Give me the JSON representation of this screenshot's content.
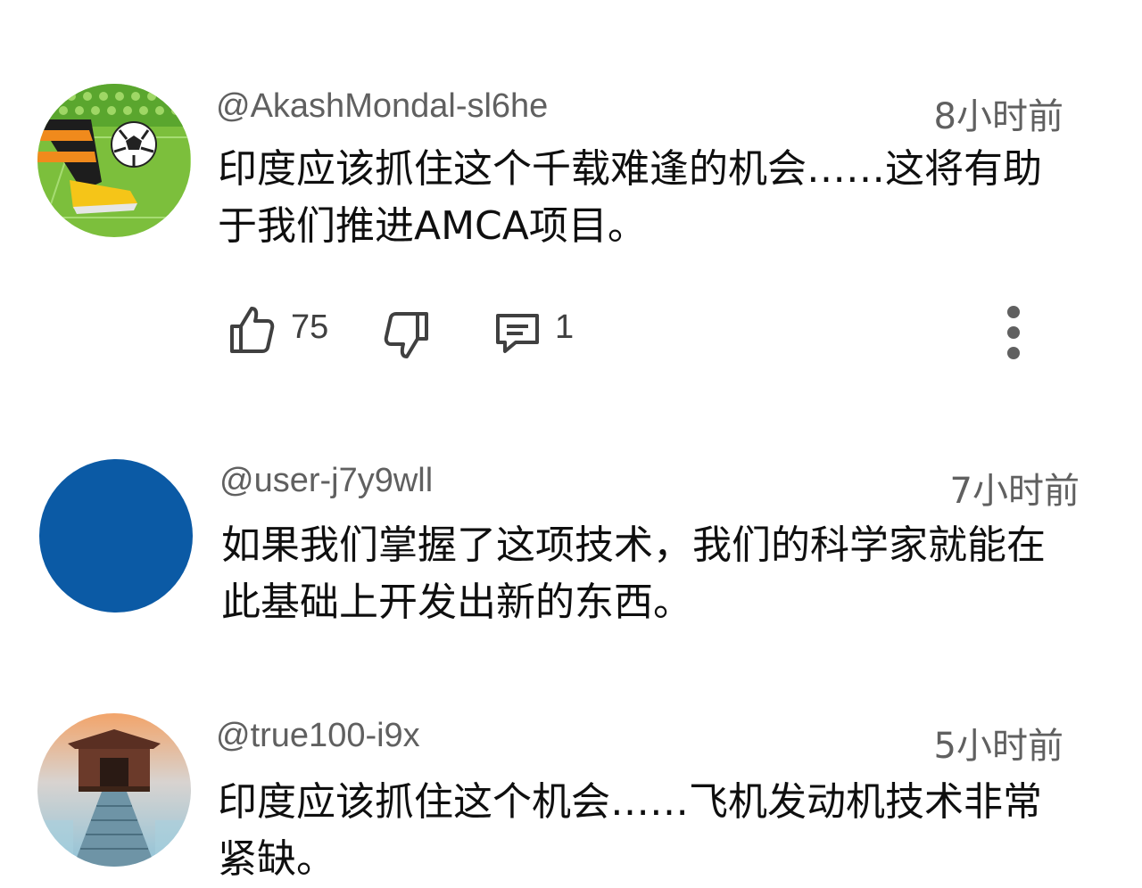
{
  "comments": [
    {
      "author": "@AkashMondal-sl6he",
      "time": "8小时前",
      "text": "印度应该抓住这个千载难逢的机会……这将有助于我们推进AMCA项目。",
      "likes": "75",
      "replies": "1",
      "avatar": "soccer-ball-avatar"
    },
    {
      "author": "@user-j7y9wll",
      "time": "7小时前",
      "text": "如果我们掌握了这项技术，我们的科学家就能在此基础上开发出新的东西。",
      "avatar": "blue-circle-avatar"
    },
    {
      "author": "@true100-i9x",
      "time": "5小时前",
      "text": "印度应该抓住这个机会……飞机发动机技术非常紧缺。",
      "avatar": "pier-hut-avatar"
    }
  ],
  "colors": {
    "meta_text": "#606060",
    "body_text": "#0f0f0f",
    "avatar_blue": "#0b5aa5"
  }
}
